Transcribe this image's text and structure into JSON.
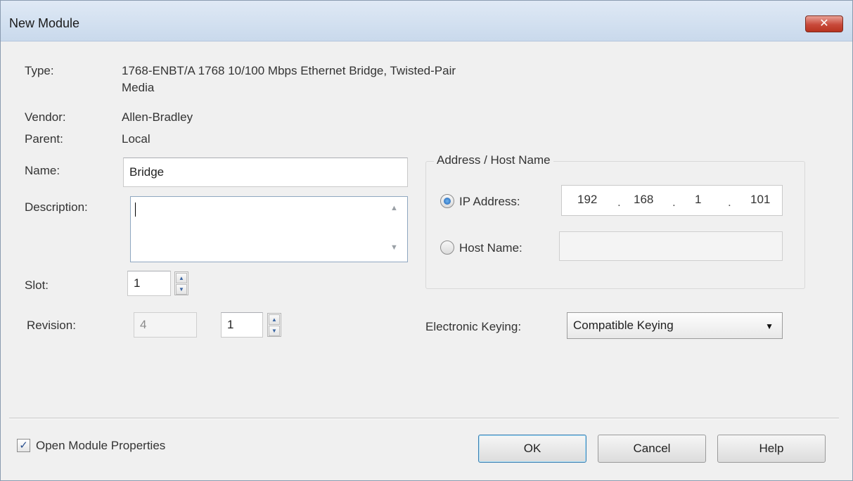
{
  "window": {
    "title": "New Module",
    "close_label": "✕"
  },
  "fields": {
    "type_label": "Type:",
    "type_value_line1": "1768-ENBT/A 1768 10/100 Mbps Ethernet Bridge, Twisted-Pair",
    "type_value_line2": "Media",
    "vendor_label": "Vendor:",
    "vendor_value": "Allen-Bradley",
    "parent_label": "Parent:",
    "parent_value": "Local",
    "name_label": "Name:",
    "name_value": "Bridge",
    "description_label": "Description:",
    "description_value": "",
    "slot_label": "Slot:",
    "slot_value": "1",
    "revision_label": "Revision:",
    "revision_major": "4",
    "revision_minor": "1"
  },
  "address_group": {
    "title": "Address / Host Name",
    "ip_label": "IP Address:",
    "ip_octets": [
      "192",
      "168",
      "1",
      "101"
    ],
    "ip_selected": true,
    "host_label": "Host Name:",
    "host_value": ""
  },
  "keying": {
    "label": "Electronic Keying:",
    "selected": "Compatible Keying"
  },
  "footer": {
    "open_properties_label": "Open Module Properties",
    "open_properties_checked": true,
    "ok_label": "OK",
    "cancel_label": "Cancel",
    "help_label": "Help"
  },
  "icons": {
    "close": "close-icon",
    "radio_selected": "radio-selected-icon",
    "dropdown": "chevron-down-icon",
    "checkmark": "checkmark-icon"
  }
}
